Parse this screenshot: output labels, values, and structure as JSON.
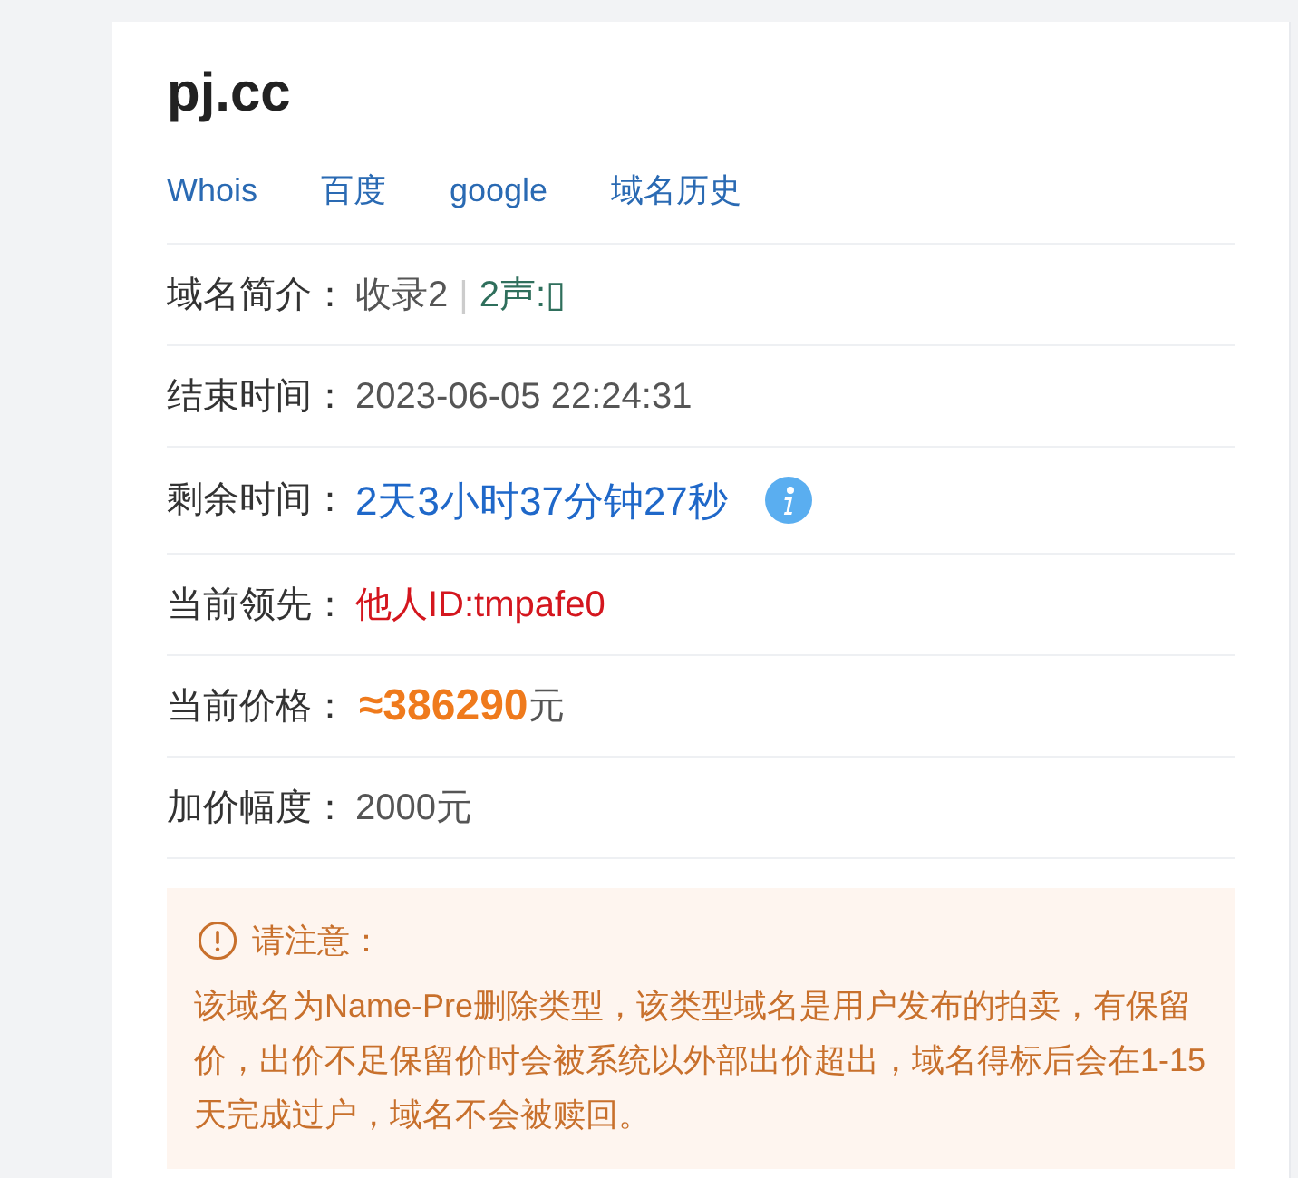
{
  "domain": {
    "title": "pj.cc"
  },
  "links": [
    {
      "label": "Whois"
    },
    {
      "label": "百度"
    },
    {
      "label": "google"
    },
    {
      "label": "域名历史"
    }
  ],
  "fields": [
    {
      "label": "域名简介：",
      "kind": "plain",
      "parts": [
        {
          "text": "收录2",
          "kind": "plain"
        },
        {
          "text": "|",
          "kind": "separator"
        },
        {
          "text": "2声:▯",
          "kind": "tag"
        }
      ]
    },
    {
      "label": "结束时间：",
      "kind": "plain",
      "parts": [
        {
          "text": "2023-06-05 22:24:31",
          "kind": "plain"
        }
      ]
    },
    {
      "label": "剩余时间：",
      "kind": "timer",
      "parts": [
        {
          "text": "2天3小时37分钟27秒",
          "kind": "countdown"
        }
      ]
    },
    {
      "label": "当前领先：",
      "kind": "plain",
      "parts": [
        {
          "text": "他人ID:tmpafe0",
          "kind": "leader"
        }
      ]
    },
    {
      "label": "当前价格：",
      "kind": "plain",
      "parts": [
        {
          "text": "≈386290",
          "kind": "price"
        },
        {
          "text": "元",
          "kind": "unit"
        }
      ]
    },
    {
      "label": "加价幅度：",
      "kind": "plain",
      "parts": [
        {
          "text": "2000元",
          "kind": "plain"
        }
      ]
    }
  ],
  "notice": {
    "title": "请注意：",
    "body": "该域名为Name-Pre删除类型，该类型域名是用户发布的拍卖，有保留价，出价不足保留价时会被系统以外部出价超出，域名得标后会在1-15天完成过户，域名不会被赎回。"
  }
}
